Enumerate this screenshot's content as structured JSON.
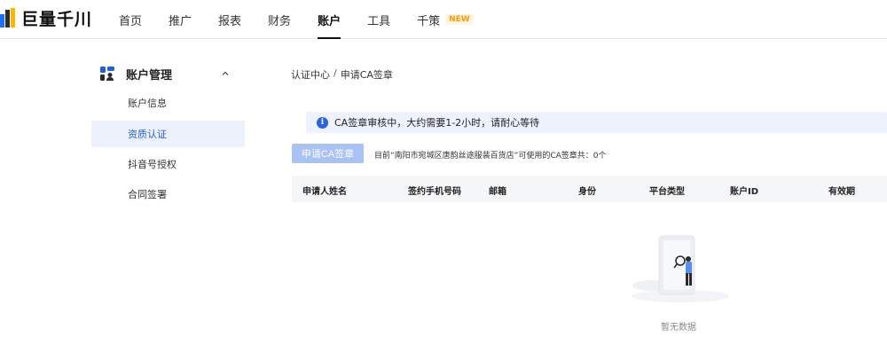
{
  "brand": {
    "name": "巨量千川"
  },
  "nav": {
    "items": [
      {
        "label": "首页"
      },
      {
        "label": "推广"
      },
      {
        "label": "报表"
      },
      {
        "label": "财务"
      },
      {
        "label": "账户",
        "active": true
      },
      {
        "label": "工具"
      },
      {
        "label": "千策",
        "badge": "NEW"
      }
    ]
  },
  "sidebar": {
    "group": {
      "label": "账户管理",
      "icon": "account-icon",
      "expanded": true
    },
    "items": [
      {
        "label": "账户信息"
      },
      {
        "label": "资质认证",
        "active": true
      },
      {
        "label": "抖音号授权"
      },
      {
        "label": "合同签署"
      }
    ]
  },
  "breadcrumb": {
    "root": "认证中心",
    "separator": "/",
    "current": "申请CA签章"
  },
  "alert": {
    "icon": "info-icon",
    "text": "CA签章审核中，大约需要1-2小时，请耐心等待"
  },
  "apply": {
    "button_label": "申请CA签章",
    "note": "目前“南阳市宛城区唐韵丝途服装百货店”可使用的CA签章共：0个"
  },
  "table": {
    "columns": [
      "申请人姓名",
      "签约手机号码",
      "邮箱",
      "身份",
      "平台类型",
      "账户ID",
      "有效期"
    ],
    "rows": []
  },
  "empty": {
    "text": "暂无数据",
    "icon": "empty-illustration"
  },
  "colors": {
    "accent": "#1f5fe0",
    "disabled_button": "#a9c2f4",
    "alert_bg": "#eef2fc",
    "new_badge": "#ff9a00"
  }
}
